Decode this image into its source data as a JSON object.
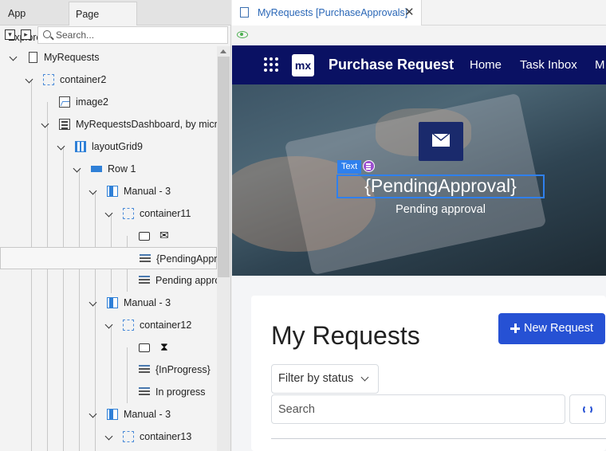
{
  "left_panel": {
    "tabs": [
      "App Explorer",
      "Page Explorer"
    ],
    "search": {
      "placeholder": "Search..."
    },
    "tree": [
      {
        "label": "MyRequests",
        "icon": "page-icon"
      },
      {
        "label": "container2",
        "icon": "container-icon"
      },
      {
        "label": "image2",
        "icon": "image-icon"
      },
      {
        "label": "MyRequestsDashboard, by microf",
        "icon": "snippet-icon"
      },
      {
        "label": "layoutGrid9",
        "icon": "layout-grid-icon"
      },
      {
        "label": "Row 1",
        "icon": "row-icon"
      },
      {
        "label": "Manual - 3",
        "icon": "column-icon"
      },
      {
        "label": "container11",
        "icon": "container-icon"
      },
      {
        "label": "✉",
        "icon": "button-icon"
      },
      {
        "label": "{PendingAppro",
        "icon": "text-icon"
      },
      {
        "label": "Pending appro",
        "icon": "text-icon"
      },
      {
        "label": "Manual - 3",
        "icon": "column-icon"
      },
      {
        "label": "container12",
        "icon": "container-icon"
      },
      {
        "label": "⧗",
        "icon": "button-icon"
      },
      {
        "label": "{InProgress}",
        "icon": "text-icon"
      },
      {
        "label": "In progress",
        "icon": "text-icon"
      },
      {
        "label": "Manual - 3",
        "icon": "column-icon"
      },
      {
        "label": "container13",
        "icon": "container-icon"
      }
    ]
  },
  "editor": {
    "tab_title": "MyRequests [PurchaseApprovals]",
    "close_glyph": "✕"
  },
  "app": {
    "logo_text": "mx",
    "title": "Purchase Request",
    "nav": [
      "Home",
      "Task Inbox",
      "M"
    ],
    "hero": {
      "widget_tag": "Text",
      "value_text": "{PendingApproval}",
      "caption": "Pending approval"
    },
    "heading": "My Requests",
    "new_button": "New Request",
    "filter_label": "Filter by status",
    "search_placeholder": "Search"
  },
  "colors": {
    "topbar": "#0a1163",
    "accent": "#2651d4",
    "selection": "#2f80ed",
    "tab_link": "#2a67b7"
  }
}
